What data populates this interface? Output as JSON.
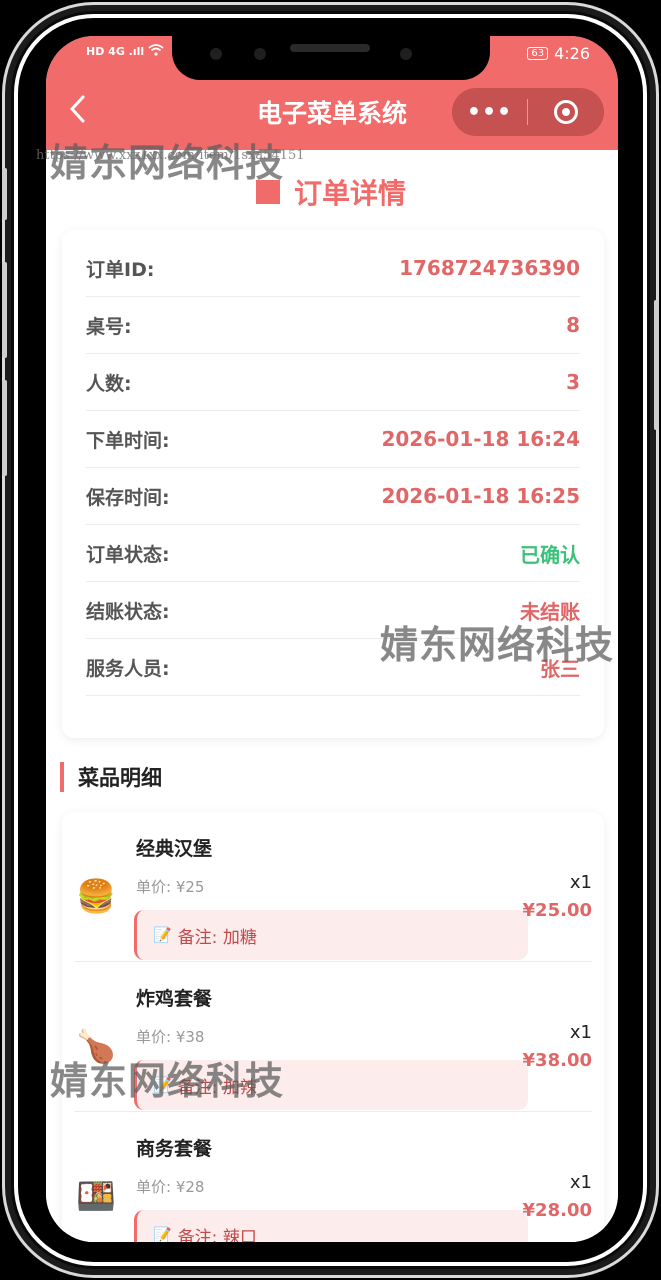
{
  "status_bar": {
    "network": "HD 4G .ıll",
    "wifi_icon": "wifi-icon",
    "battery": "63",
    "time": "4:26"
  },
  "nav": {
    "back_icon": "chevron-left-icon",
    "title": "电子菜单系统",
    "more_label": "•••",
    "target_icon": "target-icon"
  },
  "section": {
    "title": "订单详情"
  },
  "order": {
    "rows": [
      {
        "label": "订单ID:",
        "value": "1768724736390"
      },
      {
        "label": "桌号:",
        "value": "8"
      },
      {
        "label": "人数:",
        "value": "3"
      },
      {
        "label": "下单时间:",
        "value": "2026-01-18 16:24"
      },
      {
        "label": "保存时间:",
        "value": "2026-01-18 16:25"
      },
      {
        "label": "订单状态:",
        "value": "已确认"
      },
      {
        "label": "结账状态:",
        "value": "未结账"
      },
      {
        "label": "服务人员:",
        "value": "张三"
      }
    ]
  },
  "dishes": {
    "title": "菜品明细",
    "items": [
      {
        "emoji": "🍔",
        "name": "经典汉堡",
        "price": "单价: ¥25",
        "note_icon": "📝",
        "note": "备注: 加糖",
        "qty": "x1",
        "subtotal": "¥25.00"
      },
      {
        "emoji": "🍗",
        "name": "炸鸡套餐",
        "price": "单价: ¥38",
        "note_icon": "📝",
        "note": "备注: 加辣",
        "qty": "x1",
        "subtotal": "¥38.00"
      },
      {
        "emoji": "🍱",
        "name": "商务套餐",
        "price": "单价: ¥28",
        "note_icon": "📝",
        "note": "备注: 辣口",
        "qty": "x1",
        "subtotal": "¥28.00"
      }
    ]
  },
  "watermarks": {
    "text": "婧东网络科技",
    "url": "https://www.xxz1xx.com/item/1sxa54151"
  },
  "colors": {
    "accent": "#f26b6b",
    "value_red": "#e06767",
    "status_green": "#3cc07a"
  }
}
